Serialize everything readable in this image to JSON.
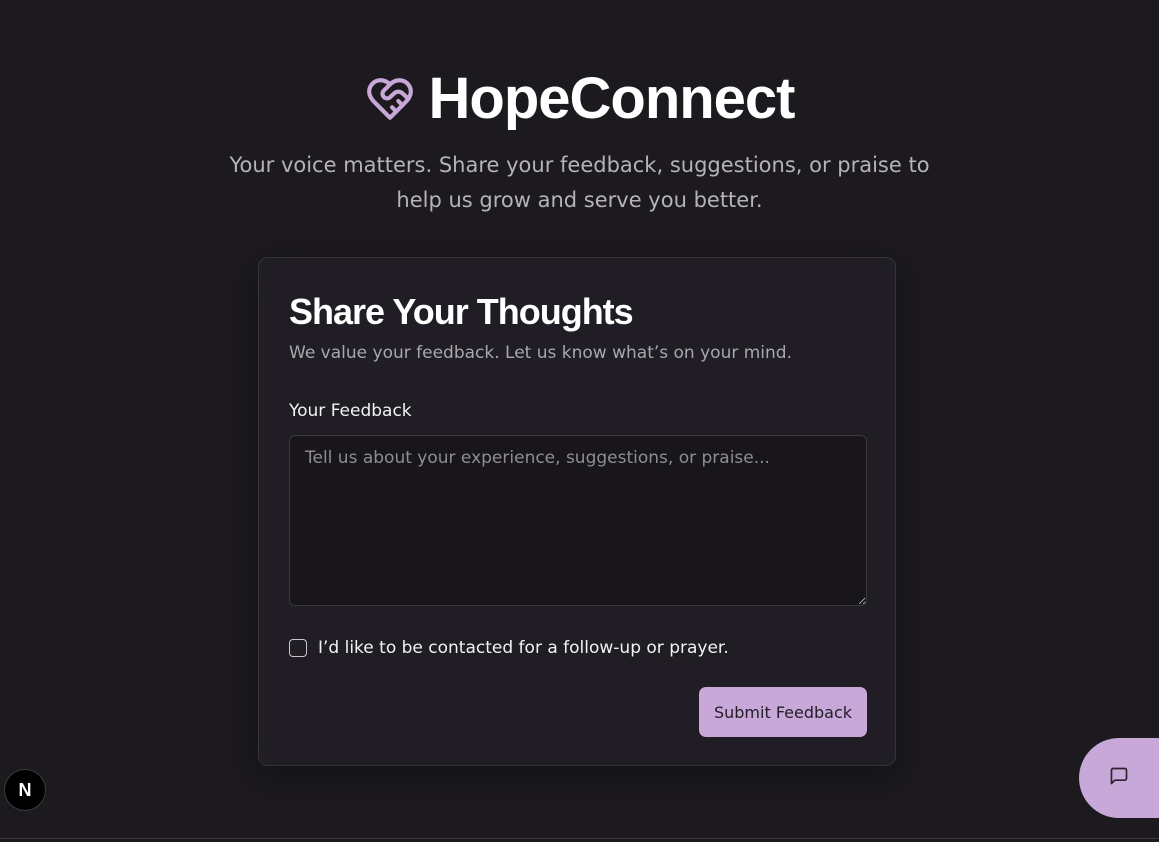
{
  "header": {
    "app_title": "HopeConnect",
    "logo_icon": "heart-handshake-icon",
    "tagline": "Your voice matters. Share your feedback, suggestions, or praise to help us grow and serve you better."
  },
  "card": {
    "title": "Share Your Thoughts",
    "subtitle": "We value your feedback. Let us know what’s on your mind.",
    "feedback_label": "Your Feedback",
    "feedback_value": "",
    "feedback_placeholder": "Tell us about your experience, suggestions, or praise...",
    "followup_checked": false,
    "followup_label": "I’d like to be contacted for a follow-up or prayer.",
    "submit_label": "Submit Feedback"
  },
  "overlays": {
    "framework_badge": "N",
    "chat_icon": "chat-bubble-icon"
  },
  "colors": {
    "background": "#1c1a1f",
    "card": "#201e24",
    "accent": "#c8a8d8",
    "text": "#f2f2f4",
    "muted": "#a9a6ae"
  }
}
